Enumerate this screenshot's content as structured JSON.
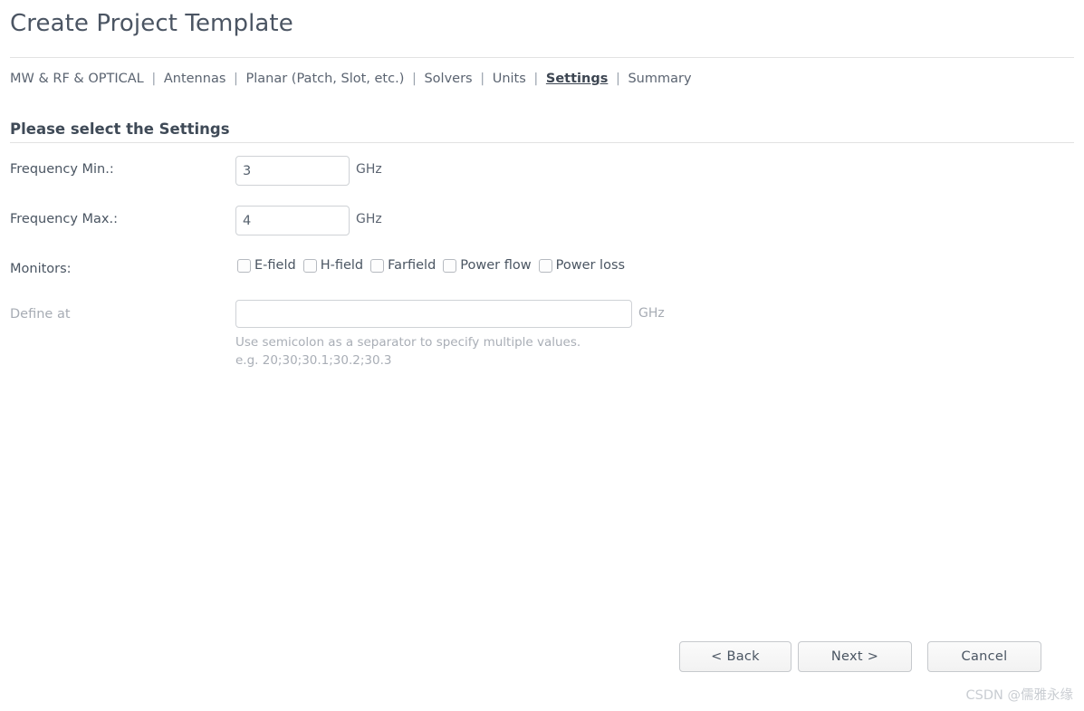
{
  "window": {
    "title": "Create Project Template"
  },
  "breadcrumb": {
    "separator": "|",
    "items": [
      {
        "label": "MW & RF & OPTICAL",
        "active": false
      },
      {
        "label": "Antennas",
        "active": false
      },
      {
        "label": "Planar (Patch, Slot, etc.)",
        "active": false
      },
      {
        "label": "Solvers",
        "active": false
      },
      {
        "label": "Units",
        "active": false
      },
      {
        "label": "Settings",
        "active": true
      },
      {
        "label": "Summary",
        "active": false
      }
    ]
  },
  "section": {
    "heading": "Please select the Settings"
  },
  "form": {
    "frequency_min": {
      "label": "Frequency Min.:",
      "value": "3",
      "placeholder": "",
      "unit": "GHz"
    },
    "frequency_max": {
      "label": "Frequency Max.:",
      "value": "4",
      "placeholder": "",
      "unit": "GHz"
    },
    "monitors": {
      "label": "Monitors:",
      "options": [
        {
          "label": "E-field",
          "checked": false
        },
        {
          "label": "H-field",
          "checked": false
        },
        {
          "label": "Farfield",
          "checked": false
        },
        {
          "label": "Power flow",
          "checked": false
        },
        {
          "label": "Power loss",
          "checked": false
        }
      ]
    },
    "define_at": {
      "label": "Define at",
      "value": "",
      "placeholder": "",
      "unit": "GHz",
      "disabled": true,
      "helper_line1": "Use semicolon as a separator to specify multiple values.",
      "helper_line2": "e.g. 20;30;30.1;30.2;30.3"
    }
  },
  "footer": {
    "back_label": "< Back",
    "next_label": "Next >",
    "cancel_label": "Cancel"
  },
  "watermark": {
    "text": "CSDN @儒雅永缘"
  },
  "colors": {
    "text": "#4a5562",
    "muted": "#a9aeb6",
    "border": "#cfd2d6",
    "divider": "#e2e2e2",
    "background": "#ffffff"
  }
}
